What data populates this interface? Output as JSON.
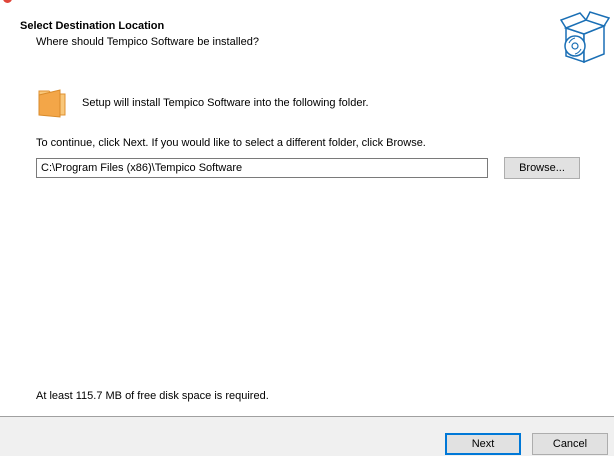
{
  "header": {
    "title": "Select Destination Location",
    "subtitle": "Where should Tempico Software be installed?"
  },
  "content": {
    "intro": "Setup will install Tempico Software into the following folder.",
    "instruction": "To continue, click Next. If you would like to select a different folder, click Browse.",
    "path_value": "C:\\Program Files (x86)\\Tempico Software",
    "browse_label": "Browse...",
    "disk_space": "At least 115.7 MB of free disk space is required."
  },
  "footer": {
    "next_label": "Next",
    "cancel_label": "Cancel"
  },
  "icons": {
    "header_graphic": "install-box-disc-icon",
    "folder": "folder-icon",
    "app_icon": "app-icon"
  },
  "colors": {
    "header_bg": "#ffffff",
    "footer_bg": "#f0f0f0",
    "folder": "#f3a648",
    "default_button_border": "#0078d7",
    "app_icon": "#e0463a"
  }
}
